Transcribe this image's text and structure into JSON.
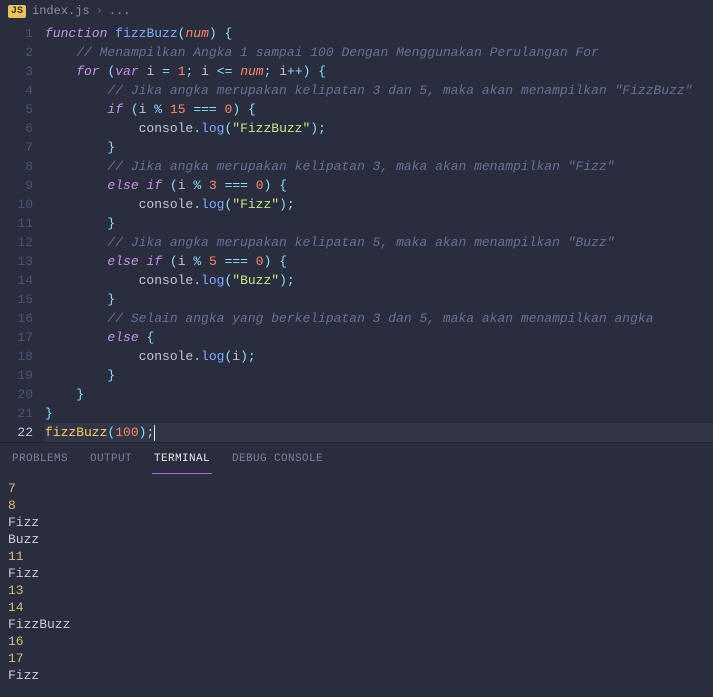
{
  "breadcrumb": {
    "filename": "index.js",
    "sep": "›",
    "ellipsis": "..."
  },
  "gutter": [
    "1",
    "2",
    "3",
    "4",
    "5",
    "6",
    "7",
    "8",
    "9",
    "10",
    "11",
    "12",
    "13",
    "14",
    "15",
    "16",
    "17",
    "18",
    "19",
    "20",
    "21",
    "22"
  ],
  "code": {
    "l1": {
      "kw1": "function",
      "fn": "fizzBuzz",
      "p1": "(",
      "param": "num",
      "p2": ")",
      "br": "{"
    },
    "l2": {
      "cmt": "// Menampilkan Angka 1 sampai 100 Dengan Menggunakan Perulangan For"
    },
    "l3": {
      "kw1": "for",
      "p1": "(",
      "kw2": "var",
      "v": "i",
      "op1": "=",
      "n1": "1",
      "sc": ";",
      "v2": "i",
      "op2": "<=",
      "param": "num",
      "sc2": ";",
      "v3": "i",
      "op3": "++",
      "p2": ")",
      "br": "{"
    },
    "l4": {
      "cmt": "// Jika angka merupakan kelipatan 3 dan 5, maka akan menampilkan \"FizzBuzz\""
    },
    "l5": {
      "kw": "if",
      "p1": "(",
      "v": "i",
      "op1": "%",
      "n1": "15",
      "op2": "===",
      "n2": "0",
      "p2": ")",
      "br": "{"
    },
    "l6": {
      "obj": "console",
      "dot": ".",
      "fn": "log",
      "p1": "(",
      "str": "\"FizzBuzz\"",
      "p2": ")",
      "sc": ";"
    },
    "l7": {
      "br": "}"
    },
    "l8": {
      "cmt": "// Jika angka merupakan kelipatan 3, maka akan menampilkan \"Fizz\""
    },
    "l9": {
      "kw1": "else",
      "kw2": "if",
      "p1": "(",
      "v": "i",
      "op1": "%",
      "n1": "3",
      "op2": "===",
      "n2": "0",
      "p2": ")",
      "br": "{"
    },
    "l10": {
      "obj": "console",
      "dot": ".",
      "fn": "log",
      "p1": "(",
      "str": "\"Fizz\"",
      "p2": ")",
      "sc": ";"
    },
    "l11": {
      "br": "}"
    },
    "l12": {
      "cmt": "// Jika angka merupakan kelipatan 5, maka akan menampilkan \"Buzz\""
    },
    "l13": {
      "kw1": "else",
      "kw2": "if",
      "p1": "(",
      "v": "i",
      "op1": "%",
      "n1": "5",
      "op2": "===",
      "n2": "0",
      "p2": ")",
      "br": "{"
    },
    "l14": {
      "obj": "console",
      "dot": ".",
      "fn": "log",
      "p1": "(",
      "str": "\"Buzz\"",
      "p2": ")",
      "sc": ";"
    },
    "l15": {
      "br": "}"
    },
    "l16": {
      "cmt": "// Selain angka yang berkelipatan 3 dan 5, maka akan menampilkan angka"
    },
    "l17": {
      "kw": "else",
      "br": "{"
    },
    "l18": {
      "obj": "console",
      "dot": ".",
      "fn": "log",
      "p1": "(",
      "v": "i",
      "p2": ")",
      "sc": ";"
    },
    "l19": {
      "br": "}"
    },
    "l20": {
      "br": "}"
    },
    "l21": {
      "br": "}"
    },
    "l22": {
      "fn": "fizzBuzz",
      "p1": "(",
      "n": "100",
      "p2": ")",
      "sc": ";"
    }
  },
  "panel": {
    "tabs": {
      "problems": "PROBLEMS",
      "output": "OUTPUT",
      "terminal": "TERMINAL",
      "debug": "DEBUG CONSOLE"
    }
  },
  "terminal": {
    "lines": [
      {
        "t": "7",
        "k": "num"
      },
      {
        "t": "8",
        "k": "num"
      },
      {
        "t": "Fizz",
        "k": "txt"
      },
      {
        "t": "Buzz",
        "k": "txt"
      },
      {
        "t": "11",
        "k": "num"
      },
      {
        "t": "Fizz",
        "k": "txt"
      },
      {
        "t": "13",
        "k": "num"
      },
      {
        "t": "14",
        "k": "num"
      },
      {
        "t": "FizzBuzz",
        "k": "txt"
      },
      {
        "t": "16",
        "k": "num"
      },
      {
        "t": "17",
        "k": "num"
      },
      {
        "t": "Fizz",
        "k": "txt"
      }
    ]
  }
}
